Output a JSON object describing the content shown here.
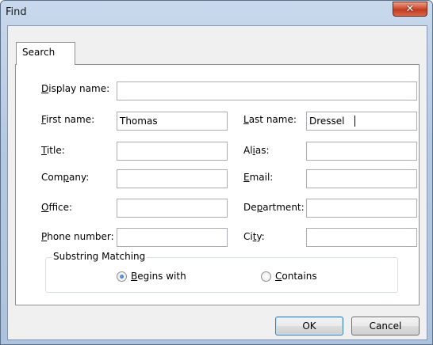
{
  "window": {
    "title": "Find",
    "close_glyph": "✕"
  },
  "tabs": [
    {
      "label": "Search"
    }
  ],
  "fields": {
    "display_name": {
      "label": "Display name:",
      "value": ""
    },
    "first_name": {
      "label": "First name:",
      "value": "Thomas"
    },
    "last_name": {
      "label": "Last name:",
      "value": "Dressel"
    },
    "title": {
      "label": "Title:",
      "value": ""
    },
    "alias": {
      "label": "Alias:",
      "value": ""
    },
    "company": {
      "label": "Company:",
      "value": ""
    },
    "email": {
      "label": "Email:",
      "value": ""
    },
    "office": {
      "label": "Office:",
      "value": ""
    },
    "department": {
      "label": "Department:",
      "value": ""
    },
    "phone_number": {
      "label": "Phone number:",
      "value": ""
    },
    "city": {
      "label": "City:",
      "value": ""
    }
  },
  "substring_matching": {
    "title": "Substring Matching",
    "options": [
      {
        "label": "Begins with",
        "checked": true
      },
      {
        "label": "Contains",
        "checked": false
      }
    ]
  },
  "buttons": {
    "ok": "OK",
    "cancel": "Cancel"
  }
}
